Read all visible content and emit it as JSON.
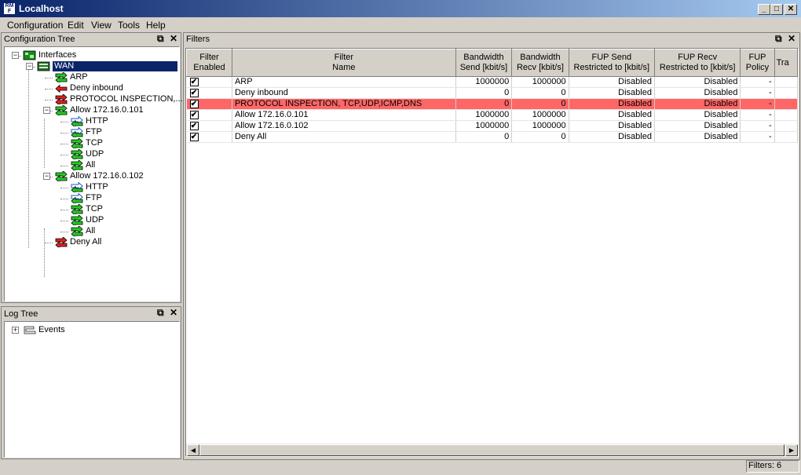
{
  "window": {
    "title": "Localhost",
    "icon_text": "RM F",
    "min_glyph": "_",
    "max_glyph": "□",
    "close_glyph": "✕"
  },
  "menu": [
    "Configuration",
    "Edit",
    "View",
    "Tools",
    "Help"
  ],
  "config_tree": {
    "title": "Configuration Tree",
    "float_glyph": "⧉",
    "close_glyph": "✕",
    "nodes": [
      {
        "label": "Interfaces",
        "icon": "network-icon",
        "expander": "−"
      },
      {
        "label": "WAN",
        "icon": "interface-icon",
        "expander": "−",
        "selected": true
      },
      {
        "label": "ARP",
        "icon": "arrow-both-icon"
      },
      {
        "label": "Deny inbound",
        "icon": "arrow-left-red-icon"
      },
      {
        "label": "PROTOCOL INSPECTION,...",
        "icon": "arrow-both-red-icon"
      },
      {
        "label": "Allow 172.16.0.101",
        "icon": "arrow-both-icon",
        "expander": "−"
      },
      {
        "label": "HTTP",
        "icon": "arrow-right-icon"
      },
      {
        "label": "FTP",
        "icon": "arrow-right-icon"
      },
      {
        "label": "TCP",
        "icon": "arrow-both-icon"
      },
      {
        "label": "UDP",
        "icon": "arrow-both-icon"
      },
      {
        "label": "All",
        "icon": "arrow-both-icon"
      },
      {
        "label": "Allow 172.16.0.102",
        "icon": "arrow-both-icon",
        "expander": "−"
      },
      {
        "label": "HTTP",
        "icon": "arrow-right-icon"
      },
      {
        "label": "FTP",
        "icon": "arrow-right-icon"
      },
      {
        "label": "TCP",
        "icon": "arrow-both-icon"
      },
      {
        "label": "UDP",
        "icon": "arrow-both-icon"
      },
      {
        "label": "All",
        "icon": "arrow-both-icon"
      },
      {
        "label": "Deny All",
        "icon": "arrow-both-red-icon"
      }
    ]
  },
  "log_tree": {
    "title": "Log Tree",
    "float_glyph": "⧉",
    "close_glyph": "✕",
    "nodes": [
      {
        "label": "Events",
        "icon": "events-icon",
        "expander": "+"
      }
    ]
  },
  "filters": {
    "title": "Filters",
    "float_glyph": "⧉",
    "close_glyph": "✕",
    "columns": [
      [
        "Filter",
        "Enabled"
      ],
      [
        "Filter",
        "Name"
      ],
      [
        "Bandwidth",
        "Send [kbit/s]"
      ],
      [
        "Bandwidth",
        "Recv [kbit/s]"
      ],
      [
        "FUP Send",
        "Restricted to [kbit/s]"
      ],
      [
        "FUP Recv",
        "Restricted to [kbit/s]"
      ],
      [
        "FUP",
        "Policy"
      ],
      [
        "Tra",
        ""
      ]
    ],
    "rows": [
      {
        "enabled": "✔",
        "name": "ARP",
        "send": "1000000",
        "recv": "1000000",
        "fup_send": "Disabled",
        "fup_recv": "Disabled",
        "policy": "-"
      },
      {
        "enabled": "✔",
        "name": "Deny inbound",
        "send": "0",
        "recv": "0",
        "fup_send": "Disabled",
        "fup_recv": "Disabled",
        "policy": "-"
      },
      {
        "enabled": "✔",
        "name": "PROTOCOL INSPECTION, TCP,UDP,ICMP,DNS",
        "send": "0",
        "recv": "0",
        "fup_send": "Disabled",
        "fup_recv": "Disabled",
        "policy": "-",
        "selected": true
      },
      {
        "enabled": "✔",
        "name": "Allow 172.16.0.101",
        "send": "1000000",
        "recv": "1000000",
        "fup_send": "Disabled",
        "fup_recv": "Disabled",
        "policy": "-"
      },
      {
        "enabled": "✔",
        "name": "Allow 172.16.0.102",
        "send": "1000000",
        "recv": "1000000",
        "fup_send": "Disabled",
        "fup_recv": "Disabled",
        "policy": "-"
      },
      {
        "enabled": "✔",
        "name": "Deny All",
        "send": "0",
        "recv": "0",
        "fup_send": "Disabled",
        "fup_recv": "Disabled",
        "policy": "-"
      }
    ],
    "scroll_left_glyph": "◀",
    "scroll_right_glyph": "▶"
  },
  "status": {
    "filters_count": "Filters: 6"
  },
  "colors": {
    "selected_row": "#ff6666",
    "tree_selection": "#0a246a",
    "title_bar": "#0a246a"
  }
}
